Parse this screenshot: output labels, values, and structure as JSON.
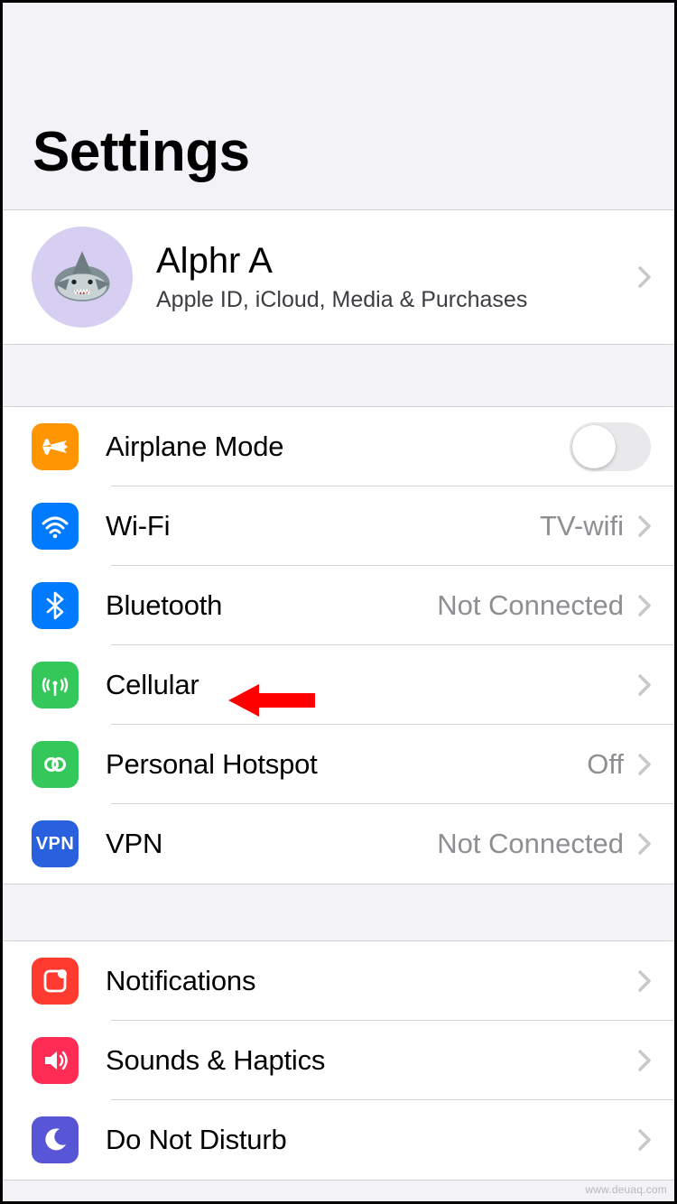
{
  "page": {
    "title": "Settings"
  },
  "account": {
    "name": "Alphr A",
    "subtitle": "Apple ID, iCloud, Media & Purchases"
  },
  "group1": {
    "airplane": {
      "label": "Airplane Mode",
      "on": false
    },
    "wifi": {
      "label": "Wi-Fi",
      "value": "TV-wifi"
    },
    "bluetooth": {
      "label": "Bluetooth",
      "value": "Not Connected"
    },
    "cellular": {
      "label": "Cellular"
    },
    "hotspot": {
      "label": "Personal Hotspot",
      "value": "Off"
    },
    "vpn": {
      "label": "VPN",
      "badge": "VPN",
      "value": "Not Connected"
    }
  },
  "group2": {
    "notifications": {
      "label": "Notifications"
    },
    "sounds": {
      "label": "Sounds & Haptics"
    },
    "dnd": {
      "label": "Do Not Disturb"
    }
  },
  "annotation": {
    "arrow_target": "cellular"
  },
  "watermark": "www.deuaq.com"
}
